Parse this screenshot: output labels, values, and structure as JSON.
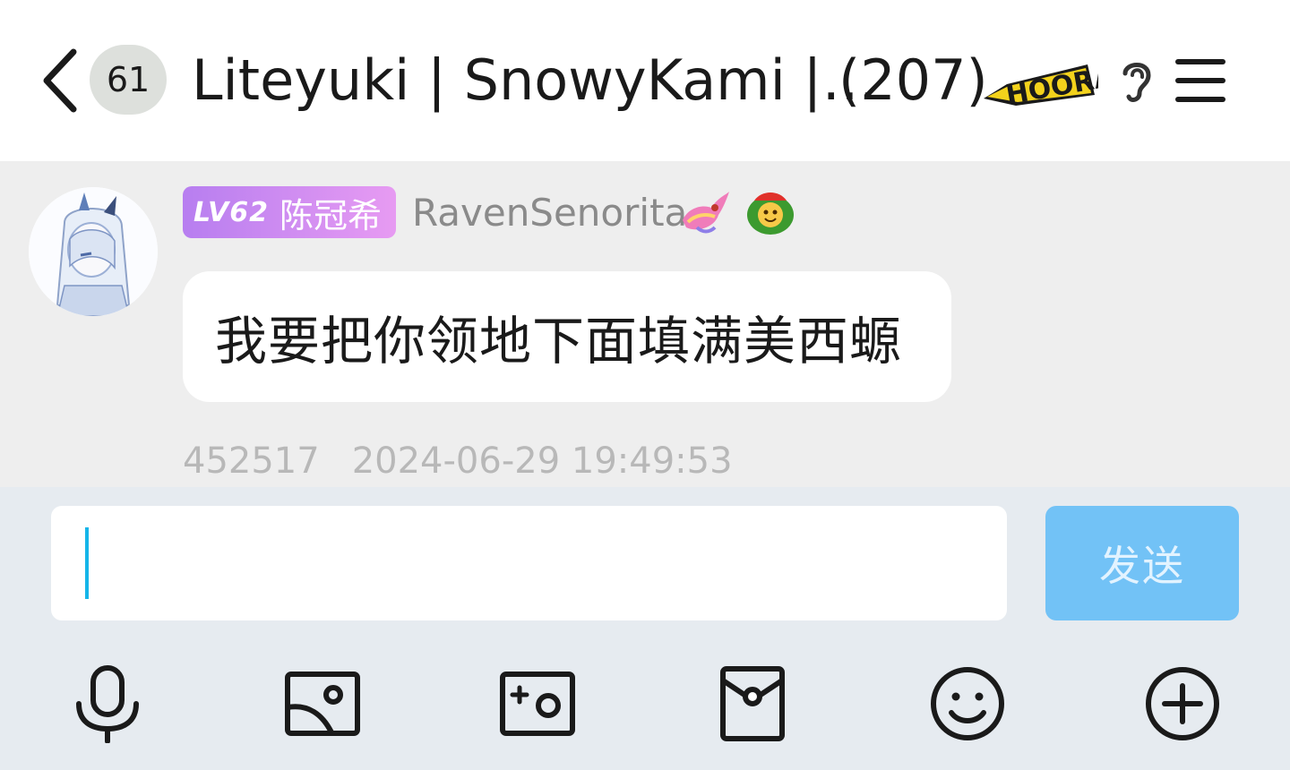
{
  "header": {
    "unread_count": "61",
    "title": "Liteyuki | SnowyKami |…",
    "member_count": "(207)",
    "badge_icon": "hooray-badge-icon",
    "icons": [
      "back-chevron-icon",
      "ear-icon",
      "menu-icon"
    ]
  },
  "message": {
    "level": "LV62",
    "title": "陈冠希",
    "nickname": "RavenSenorita",
    "text": "我要把你领地下面填满美西螈",
    "user_id": "452517",
    "timestamp": "2024-06-29 19:49:53",
    "avatar_icon": "anime-girl-avatar",
    "badges": [
      "dragon-badge-icon",
      "smiley-badge-icon"
    ]
  },
  "composer": {
    "input_value": "",
    "send_label": "发送",
    "toolbar_icons": [
      "microphone-icon",
      "image-icon",
      "camera-icon",
      "red-packet-icon",
      "emoji-icon",
      "plus-icon"
    ]
  },
  "colors": {
    "send_button": "#72c2f6",
    "caret": "#15b5e9",
    "level_tag_start": "#b77ef0",
    "level_tag_end": "#e79bf2",
    "composer_bg": "#e6ebf0"
  }
}
